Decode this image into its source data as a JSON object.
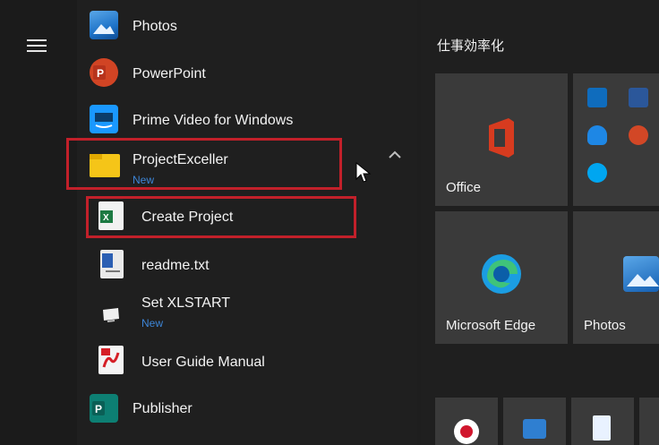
{
  "start_menu": {
    "app_list": {
      "photos_label": "Photos",
      "powerpoint_label": "PowerPoint",
      "prime_label": "Prime Video for Windows",
      "project_folder_label": "ProjectExceller",
      "project_folder_badge": "New",
      "create_project_label": "Create Project",
      "readme_label": "readme.txt",
      "xlstart_label": "Set XLSTART",
      "xlstart_badge": "New",
      "user_guide_label": "User Guide Manual",
      "publisher_label": "Publisher"
    },
    "tiles": {
      "group_title": "仕事効率化",
      "office_label": "Office",
      "edge_label": "Microsoft Edge",
      "photos_label": "Photos"
    }
  },
  "colors": {
    "highlight": "#c2202a",
    "new_badge": "#3d86d8",
    "tile_bg": "#3a3a3a"
  },
  "icons": [
    "hamburger-icon",
    "photos-icon",
    "powerpoint-icon",
    "prime-video-icon",
    "folder-icon",
    "excel-doc-icon",
    "text-file-icon",
    "monitor-icon",
    "pdf-icon",
    "publisher-icon",
    "office-icon",
    "outlook-icon",
    "word-icon",
    "onedrive-icon",
    "powerpoint-mini-icon",
    "skype-icon",
    "edge-icon",
    "photos-tile-icon",
    "record-icon",
    "calculator-icon",
    "notepad-icon",
    "chevron-up-icon",
    "mouse-cursor-icon"
  ]
}
